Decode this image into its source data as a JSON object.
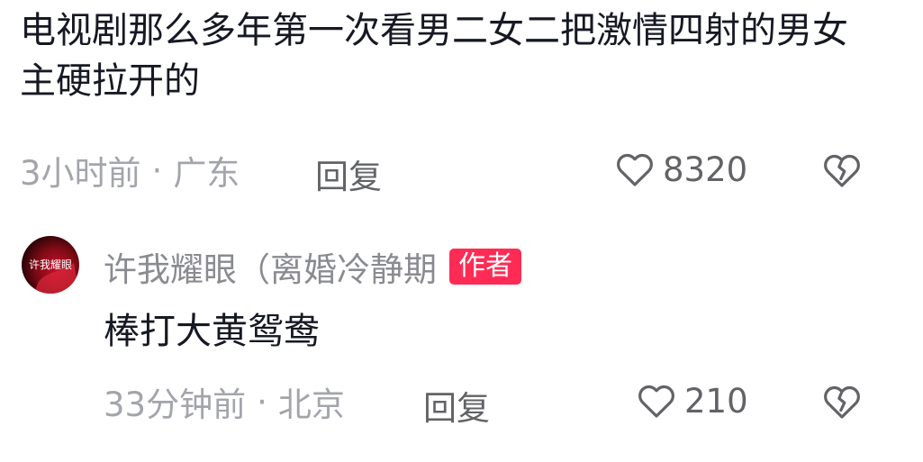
{
  "comment": {
    "text": "电视剧那么多年第一次看男二女二把激情四射的男女主硬拉开的",
    "time": "3小时前",
    "location": "广东",
    "reply_label": "回复",
    "like_count": "8320"
  },
  "reply": {
    "username": "许我耀眼（离婚冷静期",
    "badge": "作者",
    "avatar_text": "许我耀眼",
    "text": "棒打大黄鸳鸯",
    "time": "33分钟前",
    "location": "北京",
    "reply_label": "回复",
    "like_count": "210"
  },
  "meta_separator": "·",
  "colors": {
    "text_primary": "#161823",
    "text_secondary": "#a3a5ab",
    "action": "#626366",
    "badge": "#fe2c55"
  },
  "icons": {
    "like": "heart-outline-icon",
    "dislike": "broken-heart-icon"
  }
}
